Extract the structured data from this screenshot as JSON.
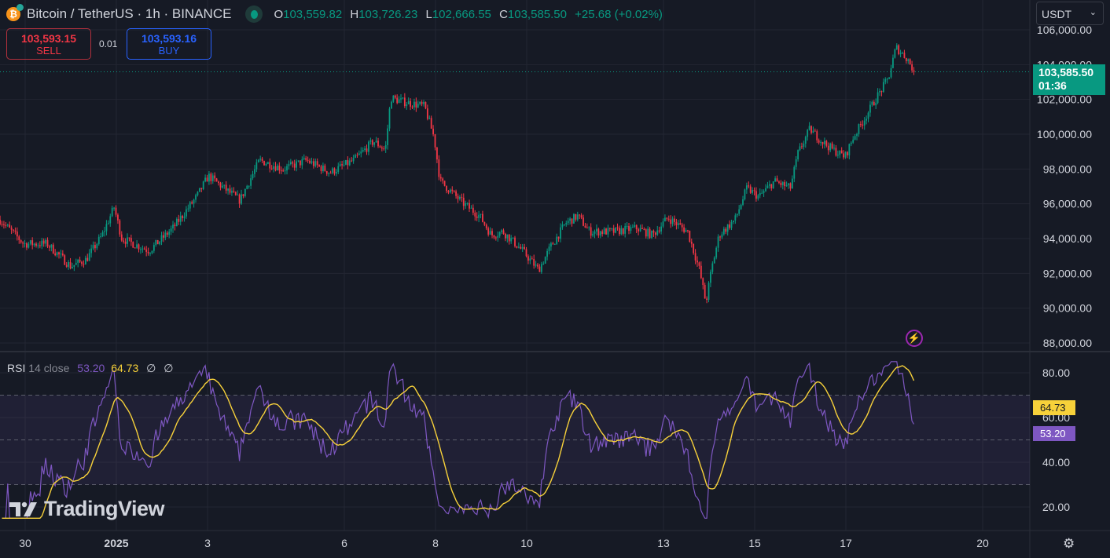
{
  "header": {
    "symbol_title": "Bitcoin / TetherUS · 1h · BINANCE",
    "coin_glyph": "₿",
    "ohlc": {
      "o_label": "O",
      "o": "103,559.82",
      "h_label": "H",
      "h": "103,726.23",
      "l_label": "L",
      "l": "102,666.55",
      "c_label": "C",
      "c": "103,585.50",
      "change": "+25.68 (+0.02%)"
    }
  },
  "trade": {
    "sell_price": "103,593.15",
    "sell_label": "SELL",
    "spread": "0.01",
    "buy_price": "103,593.16",
    "buy_label": "BUY"
  },
  "currency_select": {
    "value": "USDT"
  },
  "last_price": {
    "price": "103,585.50",
    "countdown": "01:36"
  },
  "rsi_legend": {
    "name": "RSI",
    "params": "14 close",
    "rsi_value": "53.20",
    "ma_value": "64.73",
    "extra1": "∅",
    "extra2": "∅"
  },
  "brand": {
    "name": "TradingView"
  },
  "colors": {
    "up": "#089981",
    "down": "#f23645",
    "rsi": "#7e57c2",
    "rsi_ma": "#f7d13a",
    "background": "#161a25"
  },
  "chart_data": [
    {
      "type": "candlestick",
      "title": "Bitcoin / TetherUS · 1h · BINANCE",
      "x_unit": "days since 2025-01-01 00:00",
      "ylim": [
        88000,
        106000
      ],
      "y_ticks": [
        "88,000.00",
        "90,000.00",
        "92,000.00",
        "94,000.00",
        "96,000.00",
        "98,000.00",
        "100,000.00",
        "102,000.00",
        "104,000.00",
        "106,000.00"
      ],
      "x_ticks": [
        {
          "t": -2,
          "label": "30"
        },
        {
          "t": 0,
          "label": "2025"
        },
        {
          "t": 2,
          "label": "3"
        },
        {
          "t": 5,
          "label": "6"
        },
        {
          "t": 7,
          "label": "8"
        },
        {
          "t": 9,
          "label": "10"
        },
        {
          "t": 12,
          "label": "13"
        },
        {
          "t": 14,
          "label": "15"
        },
        {
          "t": 16,
          "label": "17"
        },
        {
          "t": 19,
          "label": "20"
        }
      ],
      "close_path": [
        [
          -2.55,
          95080
        ],
        [
          -2.03,
          93700
        ],
        [
          -1.52,
          93700
        ],
        [
          -1.0,
          92400
        ],
        [
          -0.66,
          92800
        ],
        [
          -0.31,
          94200
        ],
        [
          -0.05,
          95800
        ],
        [
          0.12,
          94000
        ],
        [
          0.72,
          93300
        ],
        [
          1.24,
          94600
        ],
        [
          1.76,
          96400
        ],
        [
          2.02,
          97600
        ],
        [
          2.36,
          96900
        ],
        [
          2.71,
          96200
        ],
        [
          3.14,
          98500
        ],
        [
          3.66,
          98000
        ],
        [
          4.17,
          98500
        ],
        [
          4.69,
          97800
        ],
        [
          5.21,
          98500
        ],
        [
          5.64,
          99600
        ],
        [
          5.9,
          99100
        ],
        [
          6.02,
          102100
        ],
        [
          6.24,
          101900
        ],
        [
          6.76,
          101600
        ],
        [
          6.97,
          99800
        ],
        [
          7.1,
          97300
        ],
        [
          7.62,
          96000
        ],
        [
          7.97,
          95300
        ],
        [
          8.22,
          94200
        ],
        [
          8.48,
          94400
        ],
        [
          8.91,
          93300
        ],
        [
          9.26,
          92200
        ],
        [
          9.52,
          93500
        ],
        [
          9.86,
          94900
        ],
        [
          10.12,
          95300
        ],
        [
          10.38,
          94400
        ],
        [
          10.9,
          94400
        ],
        [
          11.41,
          94600
        ],
        [
          11.76,
          94200
        ],
        [
          12.1,
          95200
        ],
        [
          12.53,
          94400
        ],
        [
          12.79,
          92200
        ],
        [
          12.93,
          90300
        ],
        [
          13.05,
          92200
        ],
        [
          13.22,
          94200
        ],
        [
          13.57,
          95100
        ],
        [
          13.83,
          96900
        ],
        [
          14.09,
          96400
        ],
        [
          14.43,
          97300
        ],
        [
          14.78,
          96900
        ],
        [
          14.95,
          98900
        ],
        [
          15.21,
          100300
        ],
        [
          15.47,
          99600
        ],
        [
          15.72,
          99100
        ],
        [
          15.98,
          98700
        ],
        [
          16.16,
          99800
        ],
        [
          16.41,
          100900
        ],
        [
          16.67,
          102100
        ],
        [
          16.93,
          103200
        ],
        [
          17.1,
          105000
        ],
        [
          17.36,
          104300
        ],
        [
          17.5,
          103585.5
        ]
      ],
      "last_close": 103585.5
    },
    {
      "type": "line",
      "title": "RSI 14 close",
      "ylim": [
        15,
        85
      ],
      "y_ticks": [
        "20.00",
        "40.00",
        "60.00",
        "80.00"
      ],
      "bands": {
        "upper": 70,
        "middle": 50,
        "lower": 30
      },
      "series": [
        {
          "name": "RSI",
          "last": 53.2
        },
        {
          "name": "RSI-based MA",
          "last": 64.73
        }
      ]
    }
  ]
}
